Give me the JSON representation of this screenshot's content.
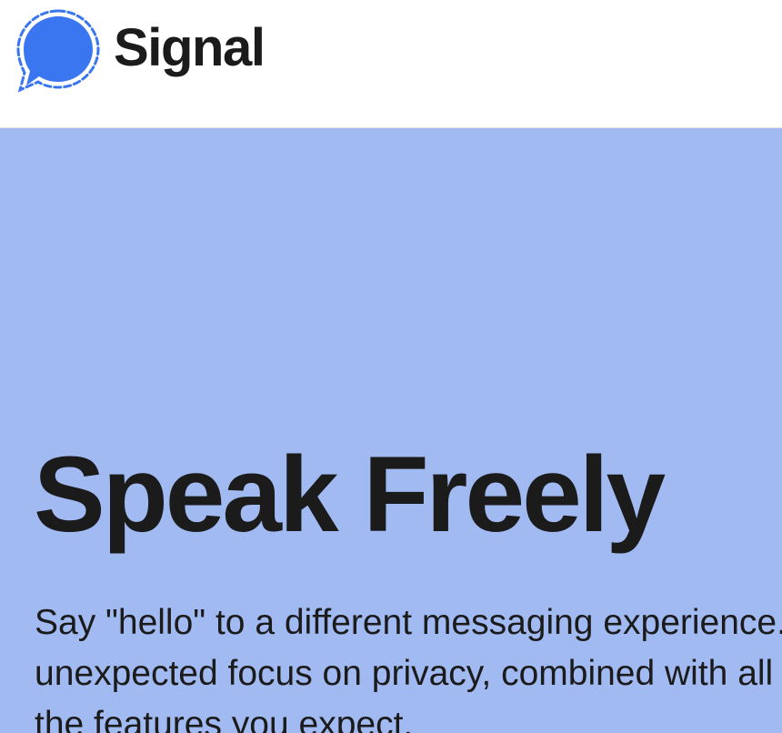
{
  "header": {
    "brand_name": "Signal",
    "logo_icon": "signal-logo-icon",
    "logo_color": "#3a76f0"
  },
  "hero": {
    "title": "Speak Freely",
    "description": "Say \"hello\" to a different messaging experience. An unexpected focus on privacy, combined with all of the features you expect.",
    "background_color": "#a2baf2"
  }
}
